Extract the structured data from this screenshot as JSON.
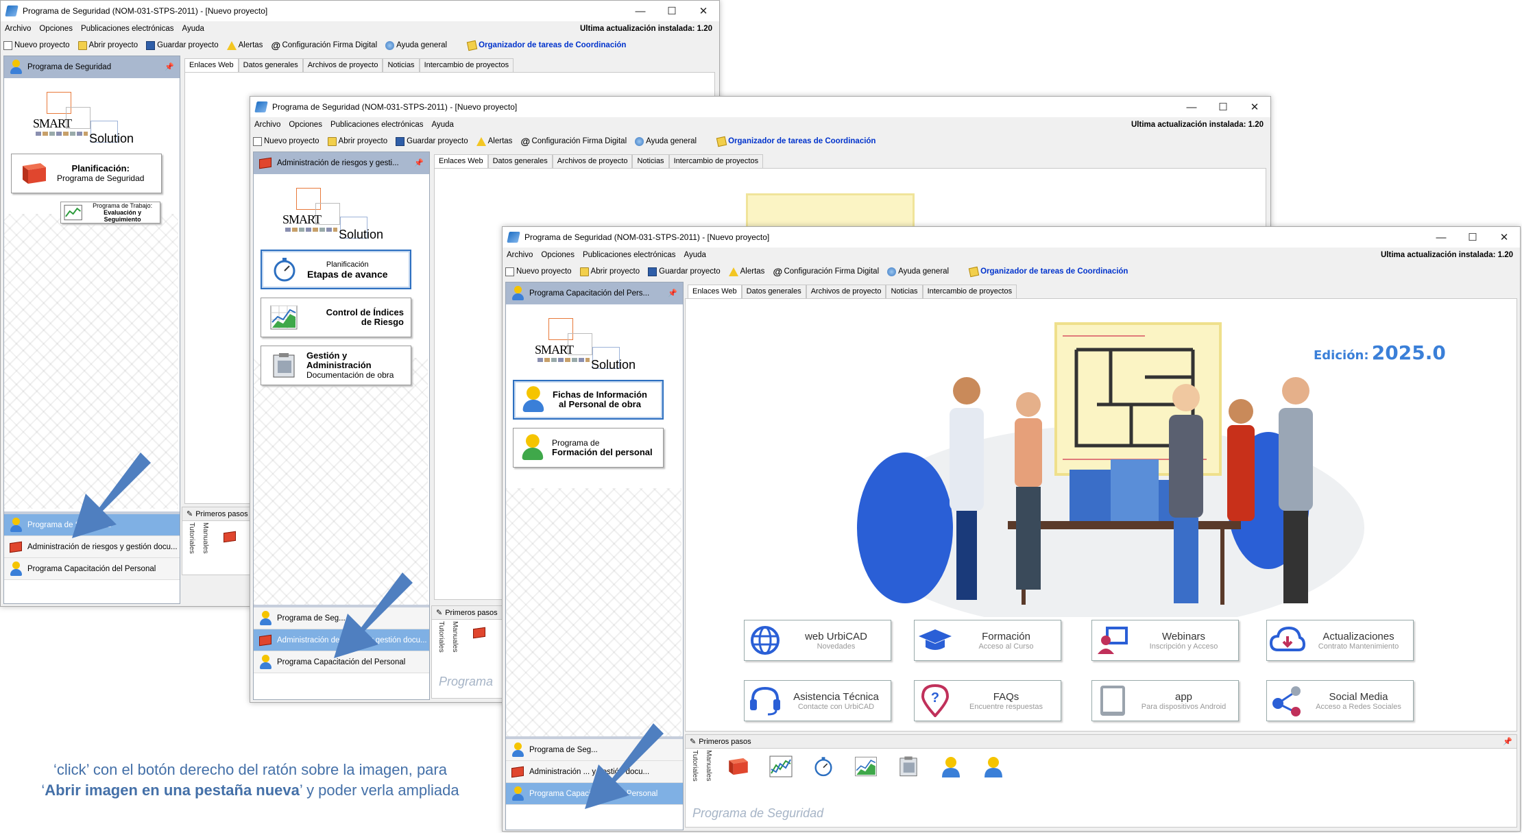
{
  "window": {
    "title": "Programa de Seguridad (NOM-031-STPS-2011) - [Nuevo proyecto]",
    "minimize": "—",
    "maximize": "☐",
    "close": "✕"
  },
  "menu": [
    "Archivo",
    "Opciones",
    "Publicaciones electrónicas",
    "Ayuda"
  ],
  "update_text": "Ultima actualización instalada: 1.20",
  "toolbar": {
    "new": "Nuevo proyecto",
    "open": "Abrir proyecto",
    "save": "Guardar proyecto",
    "alerts": "Alertas",
    "signature": "Configuración Firma Digital",
    "help": "Ayuda general",
    "organizer": "Organizador de tareas de Coordinación"
  },
  "tabs": [
    "Enlaces Web",
    "Datos generales",
    "Archivos de proyecto",
    "Noticias",
    "Intercambio de proyectos"
  ],
  "logo": {
    "text": "SMART",
    "sub": "Solution"
  },
  "win1": {
    "panel_header": "Programa de Seguridad",
    "card1": {
      "title": "Planificación:",
      "sub": "Programa de Seguridad"
    },
    "card2": {
      "title": "Programa de Trabajo:",
      "sub": "Evaluación y Seguimiento"
    },
    "items": [
      "Programa de Seguridad",
      "Administración de riesgos y gestión docu...",
      "Programa Capacitación del Personal"
    ]
  },
  "win2": {
    "panel_header": "Administración de riesgos y gesti...",
    "card1": {
      "title": "Planificación",
      "sub": "Etapas de avance"
    },
    "card2": {
      "title": "Control de Índices",
      "sub": "de Riesgo"
    },
    "card3": {
      "title": "Gestión y",
      "title2": "Administración",
      "sub": "Documentación de obra"
    },
    "items": [
      "Programa de Seg...",
      "Administración de riesgos y gestión docu...",
      "Programa Capacitación del Personal"
    ],
    "pp_footer": "Programa"
  },
  "win3": {
    "panel_header": "Programa Capacitación del Pers...",
    "card1": {
      "title": "Fichas de Información",
      "sub": "al Personal de obra"
    },
    "card2": {
      "title": "Programa de",
      "sub": "Formación del personal"
    },
    "items": [
      "Programa de Seg...",
      "Administración ... y gestión docu...",
      "Programa Capacitación del Personal"
    ],
    "edition_label": "Edición:",
    "edition_value": "2025.0",
    "quick": [
      {
        "title": "web UrbiCAD",
        "sub": "Novedades"
      },
      {
        "title": "Formación",
        "sub": "Acceso al Curso"
      },
      {
        "title": "Webinars",
        "sub": "Inscripción y Acceso"
      },
      {
        "title": "Actualizaciones",
        "sub": "Contrato Mantenimiento"
      },
      {
        "title": "Asistencia Técnica",
        "sub": "Contacte con UrbiCAD"
      },
      {
        "title": "FAQs",
        "sub": "Encuentre respuestas"
      },
      {
        "title": "app",
        "sub": "Para dispositivos Android"
      },
      {
        "title": "Social Media",
        "sub": "Acceso a Redes Sociales"
      }
    ],
    "pp_footer": "Programa de Seguridad"
  },
  "primeros_pasos": {
    "header": "Primeros pasos",
    "side1": "Tutoriales",
    "side2": "Manuales"
  },
  "caption": {
    "line1": "‘click’ con el botón derecho del ratón sobre la imagen, para",
    "line2_open": "‘",
    "line2_bold": "Abrir imagen en una pestaña nueva",
    "line2_rest": "’ y poder verla ampliada"
  },
  "colors": {
    "accent": "#2c6fc0",
    "panel_header": "#a9b8cf",
    "selected_item": "#7fb0e4",
    "edition": "#3a7fd8",
    "caption": "#4470a8"
  }
}
